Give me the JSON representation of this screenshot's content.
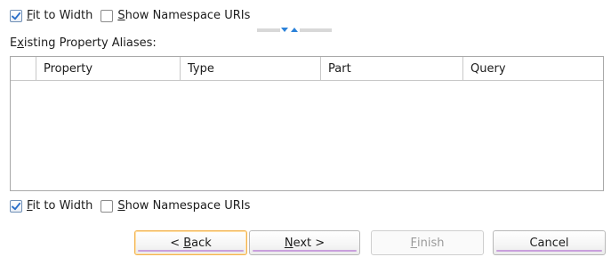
{
  "top_options": {
    "fit_to_width": {
      "checked": true,
      "label_key": "F",
      "label_rest": "it to Width"
    },
    "show_namespace": {
      "checked": false,
      "label_key": "S",
      "label_rest": "how Namespace URIs"
    }
  },
  "aliases": {
    "label_pre": "E",
    "label_key": "x",
    "label_rest": "isting Property Aliases:",
    "columns": [
      "",
      "Property",
      "Type",
      "Part",
      "Query"
    ],
    "rows": []
  },
  "bottom_options": {
    "fit_to_width": {
      "checked": true,
      "label_key": "F",
      "label_rest": "it to Width"
    },
    "show_namespace": {
      "checked": false,
      "label_key": "S",
      "label_rest": "how Namespace URIs"
    }
  },
  "buttons": {
    "back": {
      "pre": "< ",
      "key": "B",
      "rest": "ack"
    },
    "next": {
      "pre": "",
      "key": "N",
      "rest": "ext >"
    },
    "finish": {
      "pre": "",
      "key": "F",
      "rest": "inish"
    },
    "cancel": {
      "pre": "",
      "key": "",
      "rest": "Cancel"
    }
  },
  "colors": {
    "accent": "#2a6fc9",
    "focus_border": "#f2b24e",
    "button_underline": "#c9a0dc"
  },
  "icons": {
    "check": "checkmark-icon",
    "splitter": "splitter-arrows-icon"
  }
}
